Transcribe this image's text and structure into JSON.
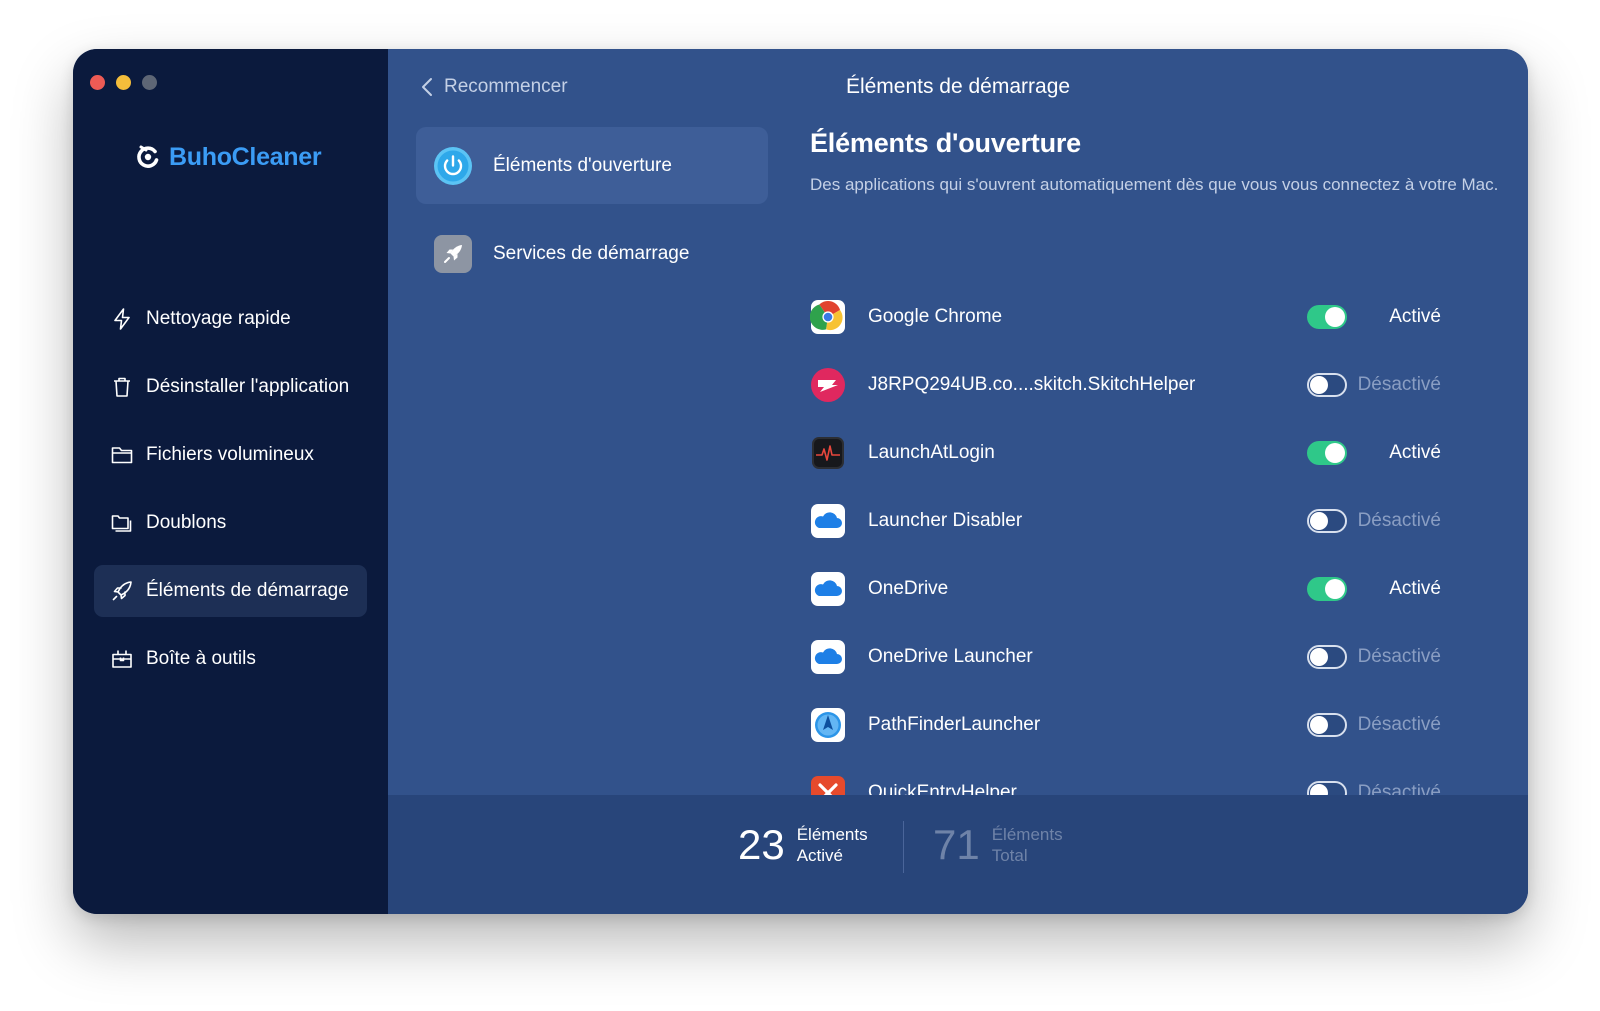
{
  "app": {
    "name": "BuhoCleaner",
    "brand_color": "#3b9cf5"
  },
  "sidebar": {
    "items": [
      {
        "label": "Nettoyage rapide",
        "icon": "bolt-icon",
        "active": false
      },
      {
        "label": "Désinstaller l'application",
        "icon": "trash-icon",
        "active": false
      },
      {
        "label": "Fichiers volumineux",
        "icon": "folder-icon",
        "active": false
      },
      {
        "label": "Doublons",
        "icon": "duplicate-folder-icon",
        "active": false
      },
      {
        "label": "Éléments de démarrage",
        "icon": "rocket-icon",
        "active": true
      },
      {
        "label": "Boîte à outils",
        "icon": "toolbox-icon",
        "active": false
      }
    ]
  },
  "header": {
    "back_label": "Recommencer",
    "title": "Éléments de démarrage"
  },
  "tabs": [
    {
      "label": "Éléments d'ouverture",
      "icon": "power-icon",
      "active": true
    },
    {
      "label": "Services de démarrage",
      "icon": "rocket-badge-icon",
      "active": false
    }
  ],
  "content": {
    "title": "Éléments d'ouverture",
    "description": "Des applications qui s'ouvrent automatiquement dès que vous vous connectez à votre Mac."
  },
  "items": [
    {
      "name": "Google Chrome",
      "icon": "chrome-icon",
      "enabled": true,
      "status": "Activé"
    },
    {
      "name": "J8RPQ294UB.co....skitch.SkitchHelper",
      "icon": "skitch-icon",
      "enabled": false,
      "status": "Désactivé"
    },
    {
      "name": "LaunchAtLogin",
      "icon": "activity-monitor-icon",
      "enabled": true,
      "status": "Activé"
    },
    {
      "name": "Launcher Disabler",
      "icon": "onedrive-icon",
      "enabled": false,
      "status": "Désactivé"
    },
    {
      "name": "OneDrive",
      "icon": "onedrive-icon",
      "enabled": true,
      "status": "Activé"
    },
    {
      "name": "OneDrive Launcher",
      "icon": "onedrive-icon",
      "enabled": false,
      "status": "Désactivé"
    },
    {
      "name": "PathFinderLauncher",
      "icon": "pathfinder-icon",
      "enabled": false,
      "status": "Désactivé"
    },
    {
      "name": "QuickEntryHelper",
      "icon": "quickentry-icon",
      "enabled": false,
      "status": "Désactivé"
    }
  ],
  "footer": {
    "enabled_count": "23",
    "enabled_label_1": "Éléments",
    "enabled_label_2": "Activé",
    "total_count": "71",
    "total_label_1": "Éléments",
    "total_label_2": "Total"
  },
  "colors": {
    "sidebar_bg": "#0b1a3d",
    "main_bg": "#32528b",
    "toggle_on": "#2fc889",
    "status_off": "#8a9ec3"
  }
}
